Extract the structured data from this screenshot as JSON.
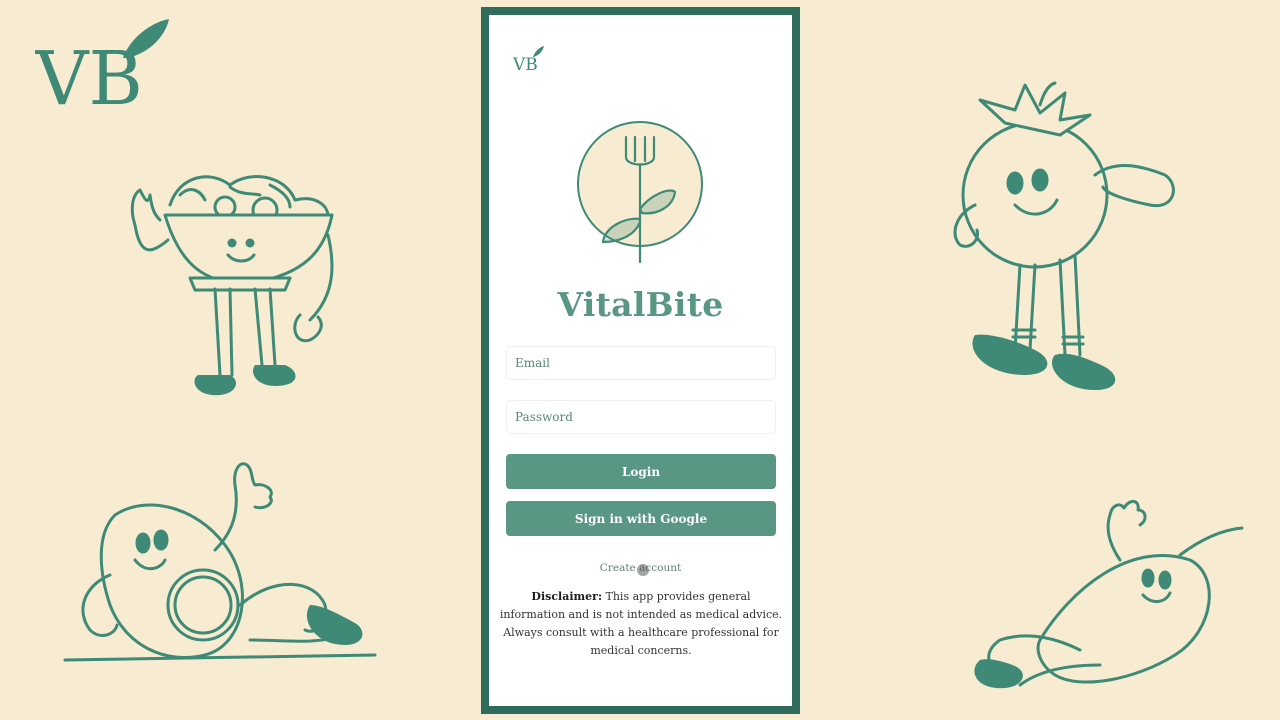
{
  "brand": {
    "monogram": "VB",
    "app_name": "VitalBite",
    "primary_color": "#5a9684",
    "frame_color": "#2f6c5c",
    "background_color": "#f7ebd1",
    "emblem_fill": "#f7ebd1"
  },
  "login_form": {
    "email_placeholder": "Email",
    "password_placeholder": "Password",
    "login_label": "Login",
    "google_label": "Sign in with Google",
    "create_account_label": "Create account"
  },
  "disclaimer": {
    "heading": "Disclaimer:",
    "text": "This app provides general information and is not intended as medical advice. Always consult with a healthcare professional for medical concerns."
  },
  "decorations": {
    "illustrations": [
      "salad-bowl-character",
      "tomato-character",
      "avocado-character",
      "pepper-character"
    ]
  }
}
